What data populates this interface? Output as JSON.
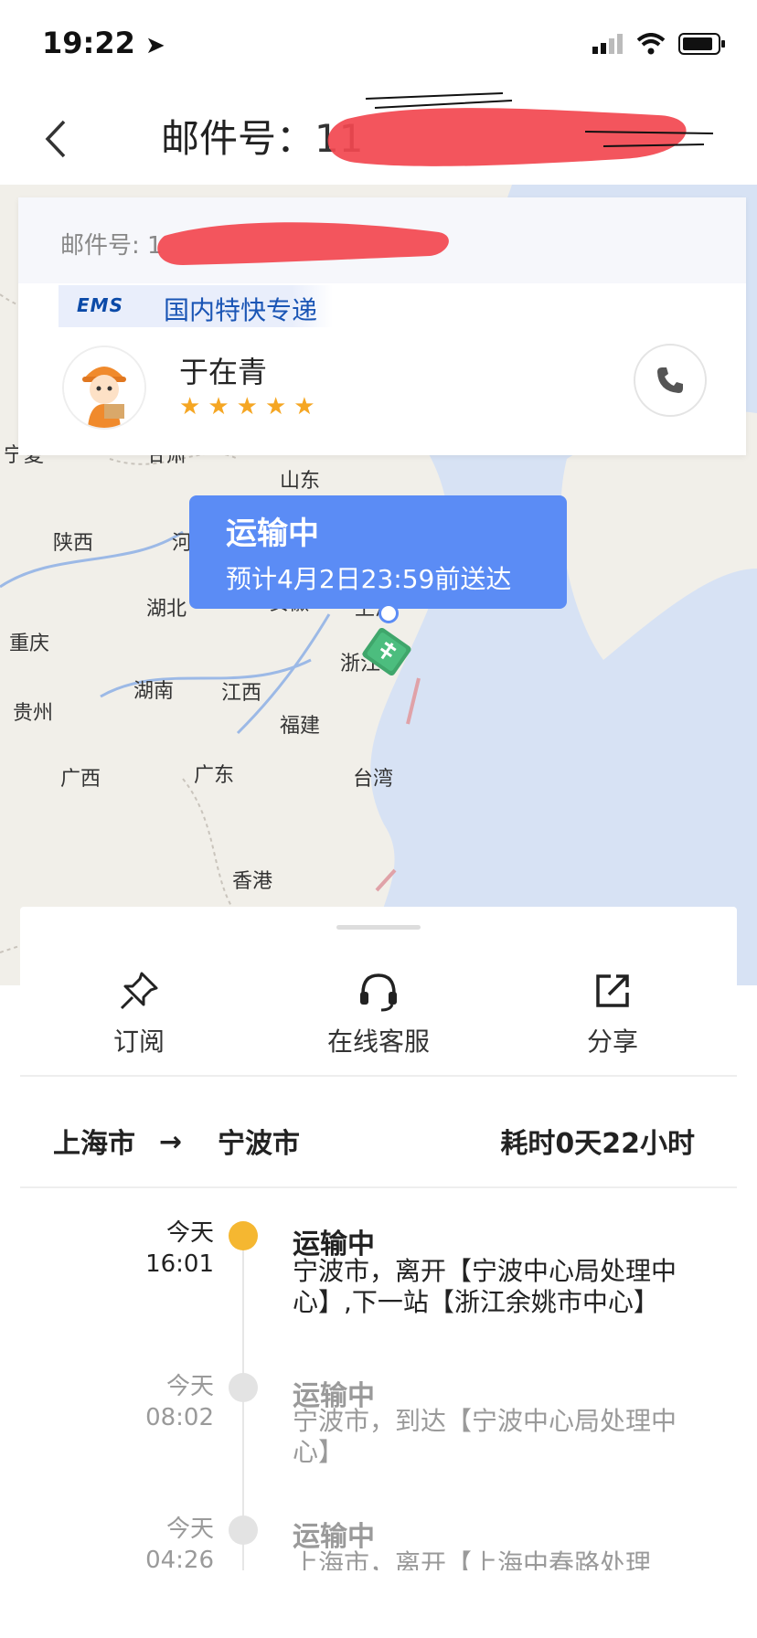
{
  "status_bar": {
    "time": "19:22"
  },
  "nav": {
    "title_prefix": "邮件号：",
    "title_visible": "11"
  },
  "card": {
    "mail_label": "邮件号: 1",
    "service_logo": "EMS",
    "service_name": "国内特快专递",
    "courier_name": "于在青",
    "rating_stars": 5
  },
  "map": {
    "labels": [
      "山东",
      "陕西",
      "河",
      "湖北",
      "安徽",
      "上海",
      "重庆",
      "浙江",
      "湖南",
      "江西",
      "贵州",
      "福建",
      "广西",
      "广东",
      "台湾",
      "香港",
      "宁夏",
      "甘肃"
    ]
  },
  "bubble": {
    "status": "运输中",
    "eta": "预计4月2日23:59前送达"
  },
  "actions": [
    {
      "label": "订阅",
      "icon": "pin-icon"
    },
    {
      "label": "在线客服",
      "icon": "headset-icon"
    },
    {
      "label": "分享",
      "icon": "share-icon"
    }
  ],
  "route": {
    "from": "上海市",
    "arrow": "→",
    "to": "宁波市",
    "duration": "耗时0天22小时"
  },
  "events": [
    {
      "day": "今天",
      "time": "16:01",
      "status": "运输中",
      "desc": "宁波市，离开【宁波中心局处理中心】,下一站【浙江余姚市中心】",
      "active": true,
      "dot_color": "#f5b731"
    },
    {
      "day": "今天",
      "time": "08:02",
      "status": "运输中",
      "desc": "宁波市，到达【宁波中心局处理中心】",
      "active": false,
      "dot_color": "#e3e3e3"
    },
    {
      "day": "今天",
      "time": "04:26",
      "status": "运输中",
      "desc": "上海市，离开【上海中春路处理",
      "active": false,
      "dot_color": "#e3e3e3"
    }
  ]
}
